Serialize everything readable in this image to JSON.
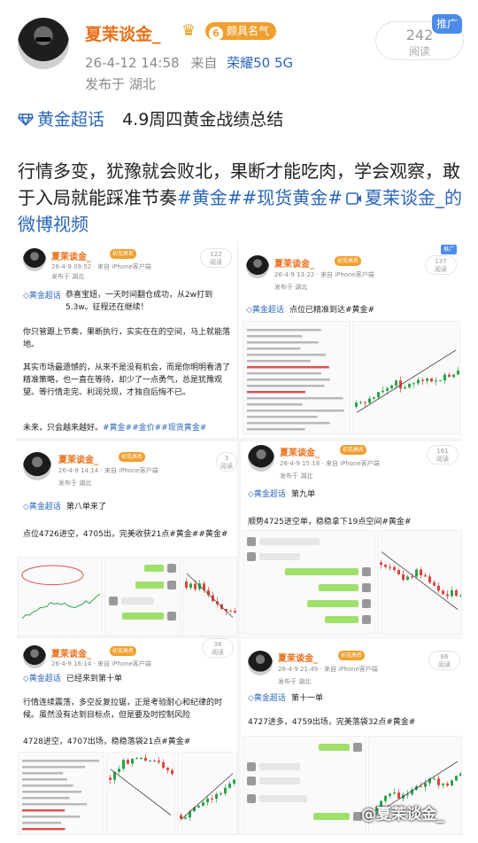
{
  "post": {
    "username": "夏茉谈金_",
    "level_badge": "颇具名气",
    "level_num": "6",
    "timestamp": "26-4-12 14:58",
    "source_prefix": "来自",
    "device": "荣耀50 5G",
    "location": "发布于 湖北",
    "read_count": "242",
    "read_label": "阅读",
    "promo_tag": "推广"
  },
  "content": {
    "topic": "黄金超话",
    "headline": "4.9周四黄金战绩总结",
    "paragraph": "行情多变，犹豫就会败北，果断才能吃肉，学会观察，敢于入局就能踩准节奏",
    "tags": [
      "#黄金#",
      "#现货黄金#"
    ],
    "video_link": "夏茉谈金_的微博视频"
  },
  "cards": [
    {
      "name": "夏茉谈金_",
      "badge": "初见高名",
      "meta": "26-4-9 09:52 · 来自 iPhone客户端",
      "loc": "发布于 湖北",
      "read": "122",
      "read_label": "阅读",
      "topic": "黄金超话",
      "topic_title": "",
      "text": "恭喜宝妞，一天时间翻仓成功，从2w打到5.3w。征程还在继续！",
      "text2": "你只管跟上节奏，果断执行，实实在在的空间，马上就能落地。",
      "text3": "其实市场最遗憾的，从来不是没有机会，而是你明明看清了精准策略，也一直在等待，却少了一点勇气，总是犹豫观望。等行情走完、利润兑现，才独自后悔不已。",
      "text4": "未来，只会越来越好。",
      "tags": "#黄金##金价##现货黄金#"
    },
    {
      "name": "夏茉谈金_",
      "badge": "初见高名",
      "meta": "26-4-9 13:22 · 来自 iPhone客户端",
      "loc": "发布于 湖北",
      "read": "137",
      "read_label": "阅读",
      "promo": "推广",
      "topic": "黄金超话",
      "topic_title": "点位已精准到达#黄金#"
    },
    {
      "name": "夏茉谈金_",
      "badge": "初见高名",
      "meta": "26-4-9 14:14 · 来自 iPhone客户端",
      "loc": "发布于 湖北",
      "read": "3",
      "read_label": "阅读",
      "topic": "黄金超话",
      "topic_title": "第八单来了",
      "text": "点位4726进空，4705出，完美收获21点#黄金##黄金#"
    },
    {
      "name": "夏茉谈金_",
      "badge": "初见高名",
      "meta": "26-4-9 15:18 · 来自 iPhone客户端",
      "loc": "发布于 湖北",
      "read": "161",
      "read_label": "阅读",
      "topic": "黄金超话",
      "topic_title": "第九单",
      "text": "顺势4725进空单，稳稳拿下19点空间#黄金#"
    },
    {
      "name": "夏茉谈金_",
      "badge": "初见高名",
      "meta": "26-4-9 16:14 · 来自 iPhone客户端",
      "loc": "",
      "read": "36",
      "read_label": "阅读",
      "topic": "黄金超话",
      "topic_title": "已经来到第十单",
      "text": "行情连续震荡，多空反复拉锯，正是考验耐心和纪律的时候。虽然没有达到目标点，但是要及时控制风险",
      "text2": "4728进空，4707出场，稳稳落袋21点#黄金#"
    },
    {
      "name": "夏茉谈金_",
      "badge": "初见高名",
      "meta": "26-4-9 21:49 · 来自 iPhone客户端",
      "loc": "发布于 湖北",
      "read": "86",
      "read_label": "阅读",
      "topic": "黄金超话",
      "topic_title": "第十一单",
      "text": "4727进多，4759出场，完美落袋32点#黄金#"
    }
  ],
  "chat_snippets": [
    "4726附近空",
    "做了4725",
    "4725附近空",
    "4727附近多",
    "4728附近空",
    "盈利出场",
    "4705出",
    "4707出场",
    "落袋"
  ],
  "watermark": "@夏茉谈金_",
  "colors": {
    "username": "#e8701a",
    "link": "#2a66b8",
    "promo": "#4c8ce8",
    "badge": "#f0a030",
    "up": "#2aa34a",
    "down": "#e0443a"
  }
}
